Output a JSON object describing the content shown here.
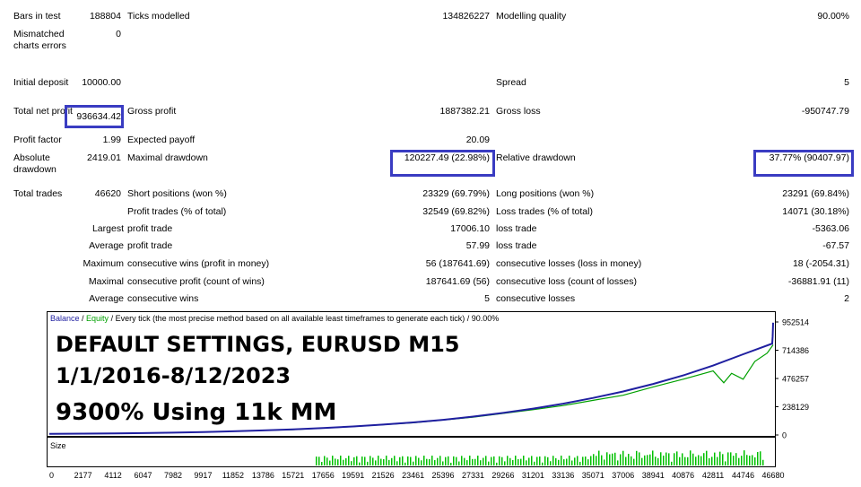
{
  "report": {
    "rows": [
      {
        "k1": "Bars in test",
        "v1": "188804",
        "k2": "Ticks modelled",
        "v2": "134826227",
        "k3": "Modelling quality",
        "v3": "90.00%"
      },
      {
        "k1": "Mismatched charts errors",
        "v1": "0"
      },
      {
        "k1": "Initial deposit",
        "v1": "10000.00",
        "k3": "Spread",
        "v3": "5"
      },
      {
        "k1": "Total net profit",
        "v1": "936634.42",
        "k2": "Gross profit",
        "v2": "1887382.21",
        "k3": "Gross loss",
        "v3": "-950747.79"
      },
      {
        "k1": "Profit factor",
        "v1": "1.99",
        "k2": "Expected payoff",
        "v2": "20.09"
      },
      {
        "k1": "Absolute drawdown",
        "v1": "2419.01",
        "k2": "Maximal drawdown",
        "v2": "120227.49 (22.98%)",
        "k3": "Relative drawdown",
        "v3": "37.77% (90407.97)"
      },
      {
        "k1": "Total trades",
        "v1": "46620",
        "k2": "Short positions (won %)",
        "v2": "23329 (69.79%)",
        "k3": "Long positions (won %)",
        "v3": "23291 (69.84%)"
      },
      {
        "k2": "Profit trades (% of total)",
        "v2": "32549 (69.82%)",
        "k3": "Loss trades (% of total)",
        "v3": "14071 (30.18%)"
      },
      {
        "p": "Largest",
        "k2": "profit trade",
        "v2": "17006.10",
        "k3": "loss trade",
        "v3": "-5363.06"
      },
      {
        "p": "Average",
        "k2": "profit trade",
        "v2": "57.99",
        "k3": "loss trade",
        "v3": "-67.57"
      },
      {
        "p": "Maximum",
        "k2": "consecutive wins (profit in money)",
        "v2": "56 (187641.69)",
        "k3": "consecutive losses (loss in money)",
        "v3": "18 (-2054.31)"
      },
      {
        "p": "Maximal",
        "k2": "consecutive profit (count of wins)",
        "v2": "187641.69 (56)",
        "k3": "consecutive loss (count of losses)",
        "v3": "-36881.91 (11)"
      },
      {
        "p": "Average",
        "k2": "consecutive wins",
        "v2": "5",
        "k3": "consecutive losses",
        "v3": "2"
      }
    ]
  },
  "chart_header": {
    "balance": "Balance",
    "sep1": " / ",
    "equity": "Equity",
    "rest": " / Every tick (the most precise method based on all available least timeframes to generate each tick)  / 90.00%"
  },
  "overlay": {
    "line1": "DEFAULT SETTINGS, EURUSD M15",
    "line2": "1/1/2016-8/12/2023",
    "line3": "9300% Using 11k MM"
  },
  "colors": {
    "balance": "#1f1fa0",
    "equity": "#00a000",
    "highlight": "#3a3cc2",
    "size": "#00c000"
  },
  "chart_data": {
    "type": "line",
    "y_ticks": [
      "952514",
      "714386",
      "476257",
      "238129",
      "0"
    ],
    "x_ticks": [
      "0",
      "2177",
      "4112",
      "6047",
      "7982",
      "9917",
      "11852",
      "13786",
      "15721",
      "17656",
      "19591",
      "21526",
      "23461",
      "25396",
      "27331",
      "29266",
      "31201",
      "33136",
      "35071",
      "37006",
      "38941",
      "40876",
      "42811",
      "44746",
      "46680"
    ],
    "size_label": "Size",
    "ylim": [
      0,
      952514
    ],
    "series": [
      {
        "name": "Balance",
        "x": [
          0,
          2177,
          4112,
          6047,
          7982,
          9917,
          11852,
          13786,
          15721,
          17656,
          19591,
          21526,
          23461,
          25396,
          27331,
          29266,
          31201,
          33136,
          35071,
          37006,
          38941,
          40876,
          42811,
          44746,
          46620,
          46650,
          46680
        ],
        "values": [
          10000,
          11000,
          13000,
          16000,
          20000,
          25000,
          31000,
          38500,
          47500,
          58500,
          72000,
          88000,
          106000,
          128000,
          155000,
          186000,
          222000,
          264000,
          312000,
          367000,
          430000,
          502000,
          585000,
          680000,
          770000,
          830000,
          946634
        ]
      },
      {
        "name": "Equity",
        "x": [
          0,
          4112,
          9917,
          15721,
          19591,
          23461,
          27331,
          31201,
          33136,
          35071,
          37006,
          38941,
          40876,
          42811,
          43500,
          44000,
          44746,
          45500,
          46300,
          46680
        ],
        "values": [
          10000,
          12000,
          24000,
          45000,
          70000,
          103000,
          150000,
          213000,
          248000,
          292000,
          335000,
          405000,
          470000,
          540000,
          440000,
          520000,
          470000,
          620000,
          690000,
          760000
        ]
      }
    ]
  }
}
